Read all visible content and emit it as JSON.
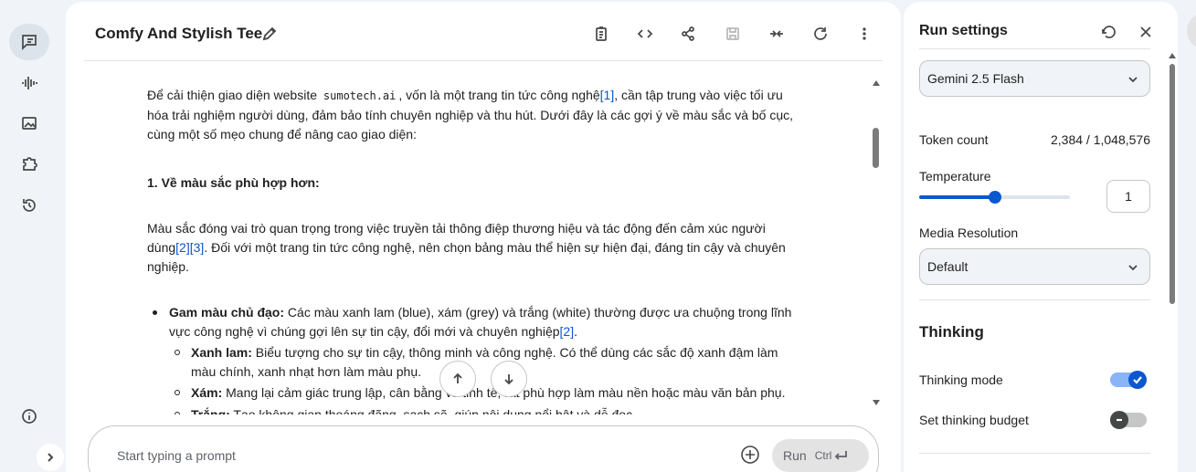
{
  "left_rail": {
    "items": [
      {
        "name": "chat-icon",
        "active": true
      },
      {
        "name": "stream-icon",
        "active": false
      },
      {
        "name": "media-gallery-icon",
        "active": false
      },
      {
        "name": "extensions-icon",
        "active": false
      },
      {
        "name": "history-icon",
        "active": false
      }
    ],
    "bottom": [
      {
        "name": "info-icon"
      },
      {
        "name": "chevron-right-icon"
      }
    ]
  },
  "header": {
    "title": "Comfy And Stylish Tee",
    "actions": [
      "compare-icon",
      "code-icon",
      "share-icon",
      "save-icon",
      "compress-icon",
      "refresh-icon",
      "more-vert-icon"
    ]
  },
  "content": {
    "para1_before": "Để cải thiện giao diện website ",
    "para1_code": "sumotech.ai",
    "para1_mid": ", vốn là một trang tin tức công nghệ",
    "cite1": "[1]",
    "para1_after": ", cần tập trung vào việc tối ưu hóa trải nghiệm người dùng, đảm bảo tính chuyên nghiệp và thu hút. Dưới đây là các gợi ý về màu sắc và bố cục, cùng một số mẹo chung để nâng cao giao diện:",
    "heading1": "1. Về màu sắc phù hợp hơn:",
    "para2_before": "Màu sắc đóng vai trò quan trọng trong việc truyền tải thông điệp thương hiệu và tác động đến cảm xúc người dùng",
    "cite2": "[2]",
    "cite3": "[3]",
    "para2_after": ". Đối với một trang tin tức công nghệ, nên chọn bảng màu thể hiện sự hiện đại, đáng tin cậy và chuyên nghiệp.",
    "bullet1_label": "Gam màu chủ đạo:",
    "bullet1_text": " Các màu xanh lam (blue), xám (grey) và trắng (white) thường được ưa chuộng trong lĩnh vực công nghệ vì chúng gợi lên sự tin cậy, đổi mới và chuyên nghiệp",
    "bullet1_cite": "[2]",
    "bullet1_end": ".",
    "sub1_label": "Xanh lam:",
    "sub1_text": " Biểu tượng cho sự tin cậy, thông minh và công nghệ. Có thể dùng các sắc độ xanh đậm làm màu chính, xanh nhạt hơn làm màu phụ.",
    "sub2_label": "Xám:",
    "sub2_text": " Mang lại cảm giác trung lập, cân bằng và tinh tế, rất phù hợp làm màu nền hoặc màu văn bản phụ.",
    "sub3_label": "Trắng:",
    "sub3_text": " Tạo không gian thoáng đãng, sạch sẽ, giúp nội dung nổi bật và dễ đọc."
  },
  "prompt": {
    "placeholder": "Start typing a prompt",
    "run_label": "Run",
    "run_shortcut": "Ctrl"
  },
  "settings": {
    "title": "Run settings",
    "model": "Gemini 2.5 Flash",
    "token_count_label": "Token count",
    "token_count_value": "2,384 / 1,048,576",
    "temperature_label": "Temperature",
    "temperature_value": "1",
    "temperature_fraction": 0.5,
    "media_resolution_label": "Media Resolution",
    "media_resolution_value": "Default",
    "thinking_title": "Thinking",
    "thinking_mode_label": "Thinking mode",
    "thinking_mode_on": true,
    "thinking_budget_label": "Set thinking budget",
    "thinking_budget_on": false
  }
}
